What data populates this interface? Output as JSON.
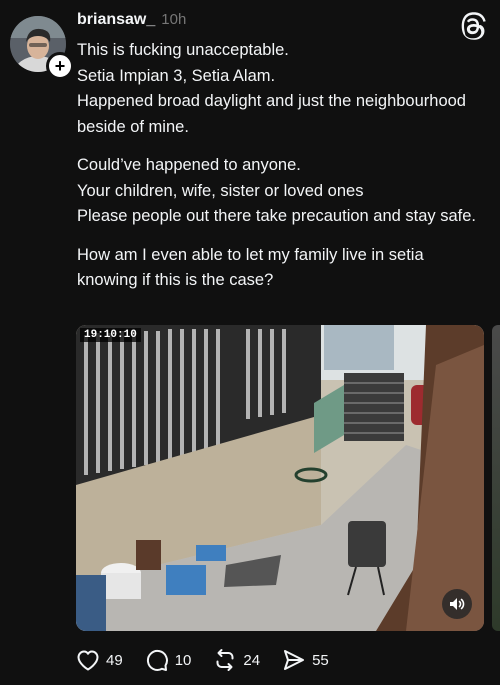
{
  "post": {
    "username": "briansaw_",
    "time": "10h",
    "lines_group1": [
      "This is fucking unacceptable.",
      "Setia Impian 3, Setia Alam.",
      "Happened broad daylight and just the neighbourhood beside of mine."
    ],
    "lines_group2": [
      "Could’ve happened to anyone.",
      "Your children, wife, sister or loved ones",
      "Please people out there take precaution and stay safe."
    ],
    "lines_group3": [
      "How am I even able to let my family live in setia knowing if this is the case?"
    ]
  },
  "video": {
    "timestamp": "19:10:10",
    "sound_icon": "speaker-icon"
  },
  "actions": {
    "likes": "49",
    "comments": "10",
    "reposts": "24",
    "shares": "55"
  },
  "colors": {
    "background": "#101010",
    "text": "#f3f5f7",
    "muted": "#777777"
  }
}
